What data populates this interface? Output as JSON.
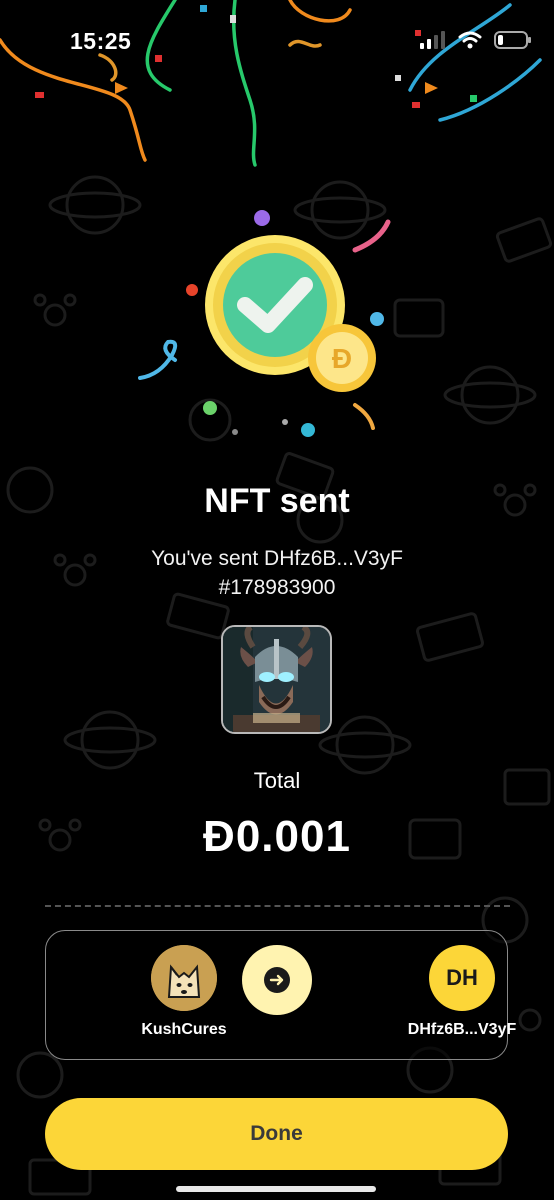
{
  "status_bar": {
    "time": "15:25"
  },
  "confirmation": {
    "title": "NFT sent",
    "subtitle_line1": "You've sent DHfz6B...V3yF",
    "subtitle_line2": "#178983900"
  },
  "total": {
    "label": "Total",
    "amount": "Đ0.001"
  },
  "transfer": {
    "from": {
      "name": "KushCures"
    },
    "to": {
      "initials": "DH",
      "name": "DHfz6B...V3yF"
    }
  },
  "actions": {
    "done_label": "Done"
  },
  "coin_symbol": "Đ",
  "colors": {
    "accent_yellow": "#fcd638",
    "check_green": "#4ecb9a",
    "background": "#000000"
  }
}
